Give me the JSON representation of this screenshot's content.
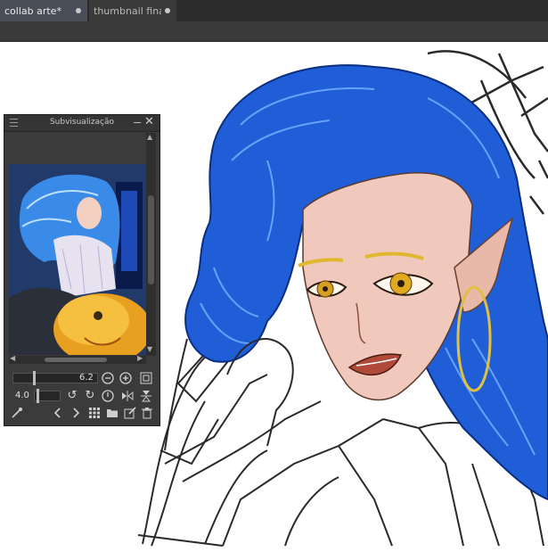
{
  "tabs": [
    {
      "label": "collab arte*",
      "active": true
    },
    {
      "label": "thumbnail finais",
      "active": false
    }
  ],
  "subview": {
    "title": "Subvisualização",
    "zoom_value": "6.2",
    "rotation_value": "4.0"
  },
  "colors": {
    "hair_blue": "#1f5ed6",
    "tab_active": "#4a4e58",
    "panel_bg": "#3b3b3b"
  }
}
